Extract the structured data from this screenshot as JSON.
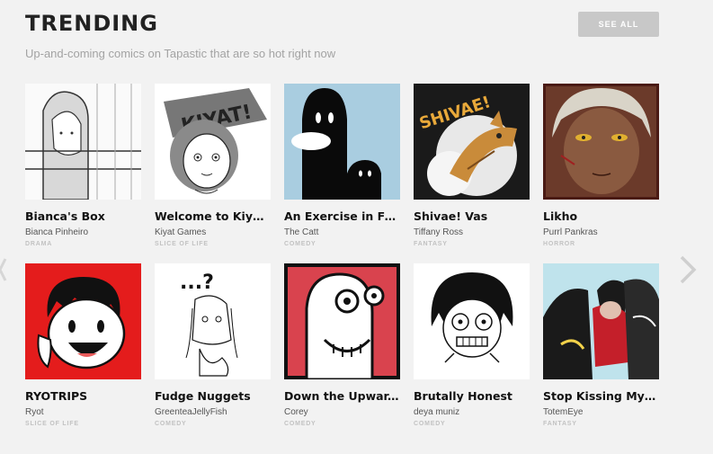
{
  "header": {
    "title": "TRENDING",
    "subtitle": "Up-and-coming comics on Tapastic that are so hot right now",
    "see_all": "SEE ALL"
  },
  "icons": {
    "next": "chevron-right-icon",
    "prev": "chevron-left-icon"
  },
  "rows": [
    [
      {
        "title": "Bianca's Box",
        "author": "Bianca Pinheiro",
        "genre": "DRAMA"
      },
      {
        "title": "Welcome to Kiyat...",
        "author": "Kiyat Games",
        "genre": "SLICE OF LIFE",
        "art_text": "KIYAT!"
      },
      {
        "title": "An Exercise in Futi...",
        "author": "The Catt",
        "genre": "COMEDY"
      },
      {
        "title": "Shivae! Vas",
        "author": "Tiffany Ross",
        "genre": "FANTASY",
        "art_text": "SHIVAE!"
      },
      {
        "title": "Likho",
        "author": "Purrl Pankras",
        "genre": "HORROR"
      }
    ],
    [
      {
        "title": "RYOTRIPS",
        "author": "Ryot",
        "genre": "SLICE OF LIFE"
      },
      {
        "title": "Fudge Nuggets",
        "author": "GreenteaJellyFish",
        "genre": "COMEDY",
        "art_text": "...?"
      },
      {
        "title": "Down the Upwar...",
        "author": "Corey",
        "genre": "COMEDY"
      },
      {
        "title": "Brutally Honest",
        "author": "deya muniz",
        "genre": "COMEDY"
      },
      {
        "title": "Stop Kissing My S...",
        "author": "TotemEye",
        "genre": "FANTASY"
      }
    ]
  ]
}
